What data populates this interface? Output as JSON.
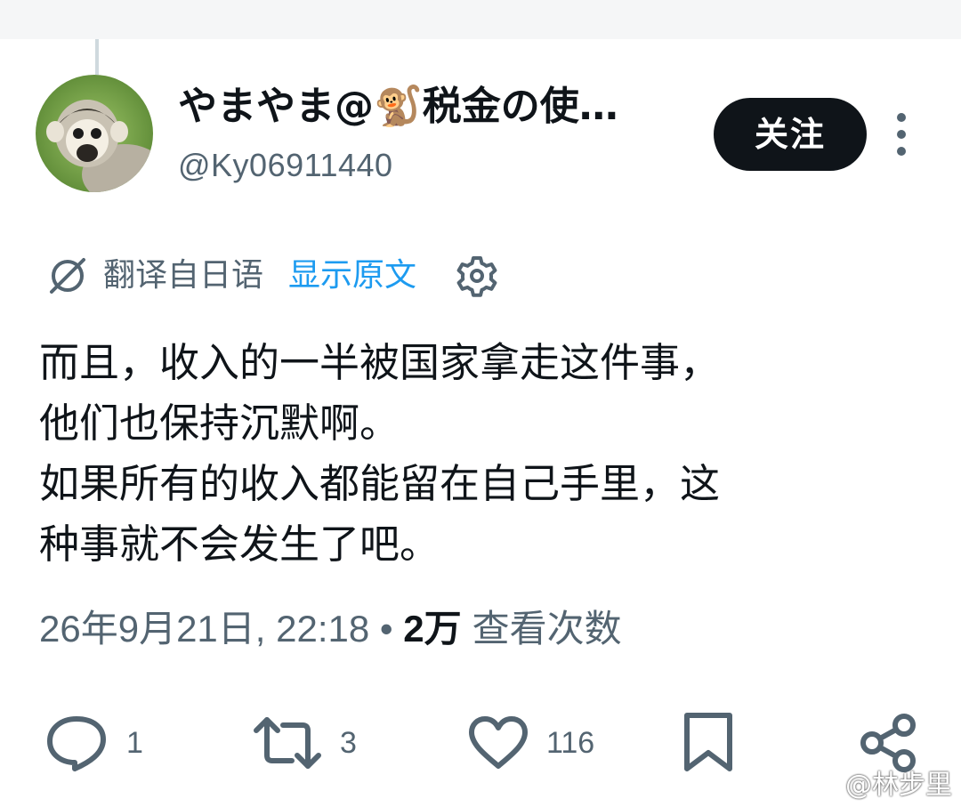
{
  "author": {
    "display_name": "やまやま@🐒税金の使…",
    "handle": "@Ky06911440",
    "follow_label": "关注"
  },
  "translation": {
    "label": "翻译自日语",
    "show_original": "显示原文"
  },
  "tweet": {
    "lines": [
      "而且，收入的一半被国家拿走这件事，",
      "他们也保持沉默啊。",
      "如果所有的收入都能留在自己手里，这",
      "种事就不会发生了吧。"
    ],
    "timestamp": "26年9月21日, 22:18",
    "separator": "•",
    "views_count": "2万",
    "views_label": "查看次数"
  },
  "actions": {
    "reply_count": "1",
    "retweet_count": "3",
    "like_count": "116"
  },
  "watermark": "@林步里",
  "colors": {
    "text": "#0f1419",
    "secondary": "#536471",
    "link": "#1d9bf0",
    "follow_bg": "#0f1419"
  }
}
